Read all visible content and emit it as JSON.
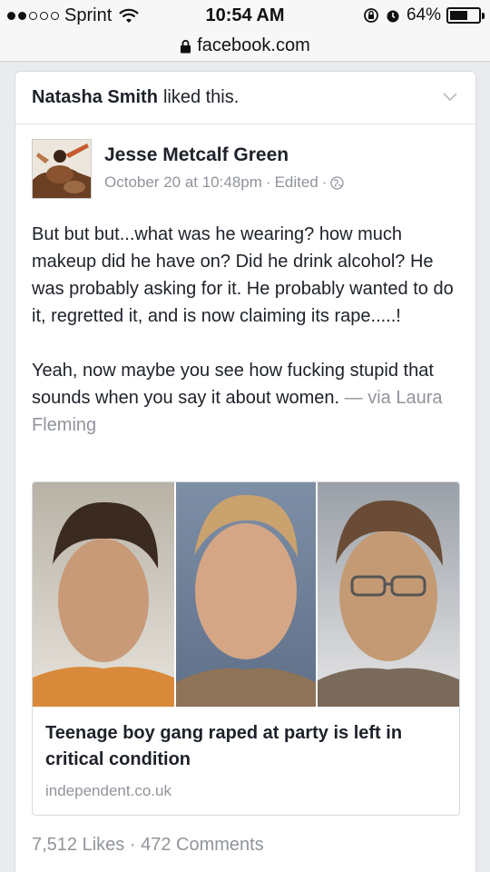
{
  "status_bar": {
    "carrier": "Sprint",
    "time": "10:54 AM",
    "battery": "64%",
    "battery_level": 0.64
  },
  "url_bar": {
    "url": "facebook.com"
  },
  "story": {
    "actor": "Natasha Smith",
    "action": "liked this."
  },
  "post": {
    "author": "Jesse Metcalf Green",
    "date": "October 20 at 10:48pm",
    "edited": "Edited",
    "paragraph1": "But but but...what was he wearing? how much makeup did he have on? Did he drink alcohol? He was probably asking for it. He probably wanted to do it, regretted it, and is now claiming its rape.....!",
    "paragraph2": "Yeah, now maybe you see how fucking stupid that sounds when you say it about women.",
    "via_prefix": "— via",
    "via_name": "Laura Fleming"
  },
  "link": {
    "title": "Teenage boy gang raped at party is left in critical condition",
    "domain": "independent.co.uk"
  },
  "stats": {
    "likes": "7,512 Likes",
    "separator": "·",
    "comments": "472 Comments"
  }
}
